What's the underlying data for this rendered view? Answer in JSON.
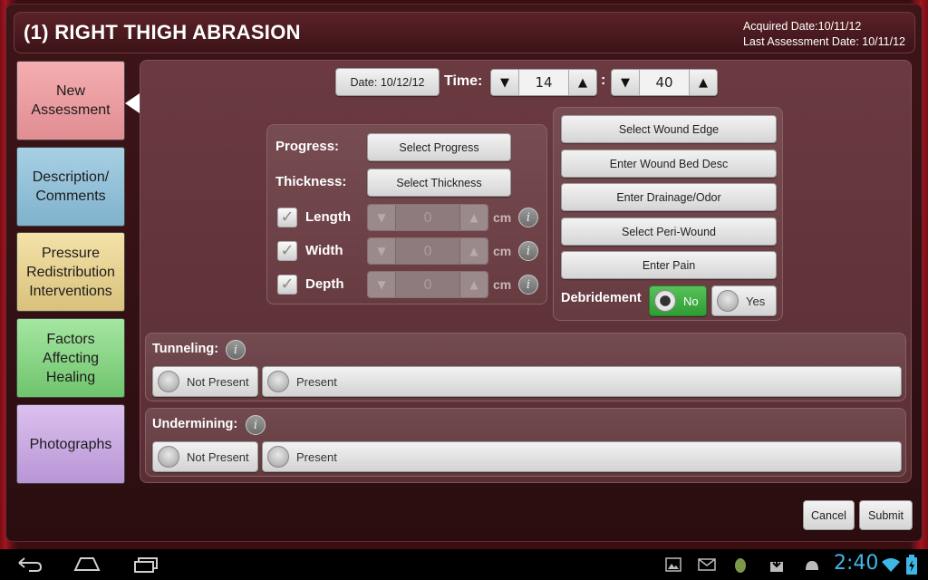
{
  "header": {
    "title": "(1) RIGHT THIGH ABRASION",
    "acquired_date": "Acquired Date:10/11/12",
    "last_assessment": "Last Assessment Date: 10/11/12"
  },
  "tabs": [
    {
      "label": "New\nAssessment",
      "active": true
    },
    {
      "label": "Description/\nComments"
    },
    {
      "label": "Pressure\nRedistribution\nInterventions"
    },
    {
      "label": "Factors\nAffecting\nHealing"
    },
    {
      "label": "Photographs"
    }
  ],
  "datetime": {
    "date_label": "Date: 10/12/12",
    "time_label": "Time:",
    "hour": "14",
    "minute": "40",
    "separator": ":"
  },
  "left_panel": {
    "progress_label": "Progress:",
    "progress_button": "Select Progress",
    "thickness_label": "Thickness:",
    "thickness_button": "Select Thickness",
    "measures": [
      {
        "label": "Length",
        "value": "0",
        "unit": "cm"
      },
      {
        "label": "Width",
        "value": "0",
        "unit": "cm"
      },
      {
        "label": "Depth",
        "value": "0",
        "unit": "cm"
      }
    ]
  },
  "right_panel": {
    "buttons": [
      "Select Wound Edge",
      "Enter Wound Bed Desc",
      "Enter Drainage/Odor",
      "Select Peri-Wound",
      "Enter Pain"
    ],
    "debridement_label": "Debridement",
    "debridement_no": "No",
    "debridement_yes": "Yes",
    "debridement_selected": "No"
  },
  "tunneling": {
    "label": "Tunneling:",
    "not_present": "Not Present",
    "present": "Present"
  },
  "undermining": {
    "label": "Undermining:",
    "not_present": "Not Present",
    "present": "Present"
  },
  "footer": {
    "cancel": "Cancel",
    "submit": "Submit"
  },
  "statusbar": {
    "time": "2:40"
  },
  "colors": {
    "accent_green": "#3fae42",
    "clock_blue": "#3fb7e6",
    "tab_new": "#e8979b"
  }
}
